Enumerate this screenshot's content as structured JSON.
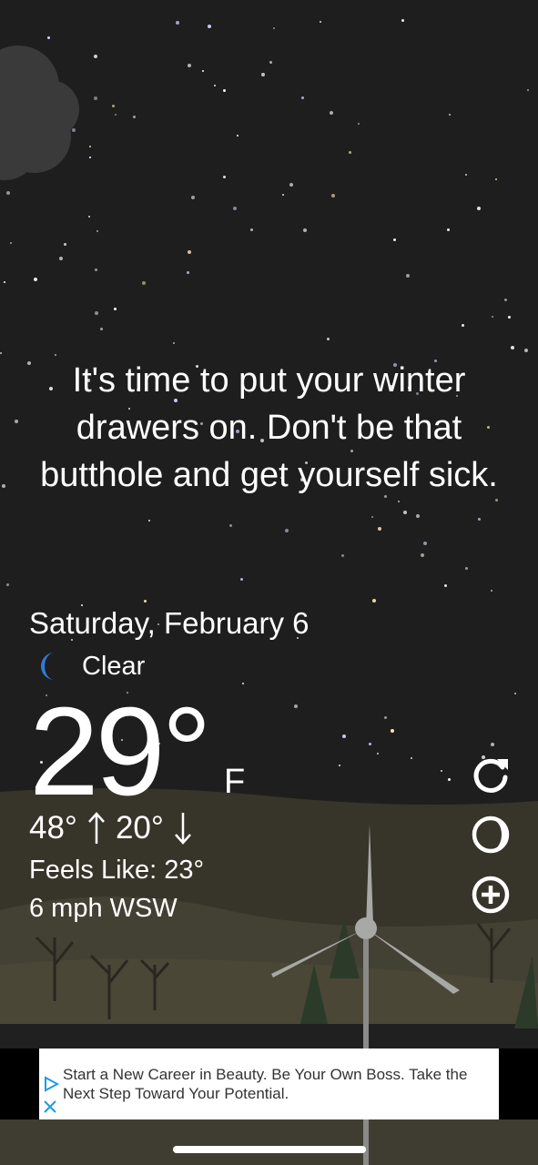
{
  "message": "It's time to put your winter drawers on. Don't be that butthole and get yourself sick.",
  "weather": {
    "date": "Saturday, February 6",
    "condition": "Clear",
    "condition_icon": "crescent-moon-icon",
    "temperature": "29°",
    "unit": "F",
    "high": "48°",
    "low": "20°",
    "feels_like": "Feels Like: 23°",
    "wind": "6 mph WSW"
  },
  "actions": [
    {
      "name": "refresh",
      "icon": "refresh-icon"
    },
    {
      "name": "theme",
      "icon": "theme-toggle-icon"
    },
    {
      "name": "add-location",
      "icon": "plus-circle-icon"
    }
  ],
  "ad": {
    "text": "Start a New Career in Beauty. Be Your Own Boss. Take the Next Step Toward Your Potential.",
    "info_icon": "ad-choices-icon",
    "close_icon": "close-icon"
  },
  "colors": {
    "sky": "#1e1e1e",
    "moon": "#2f7bd8",
    "ad_accent": "#1a9ce0"
  }
}
